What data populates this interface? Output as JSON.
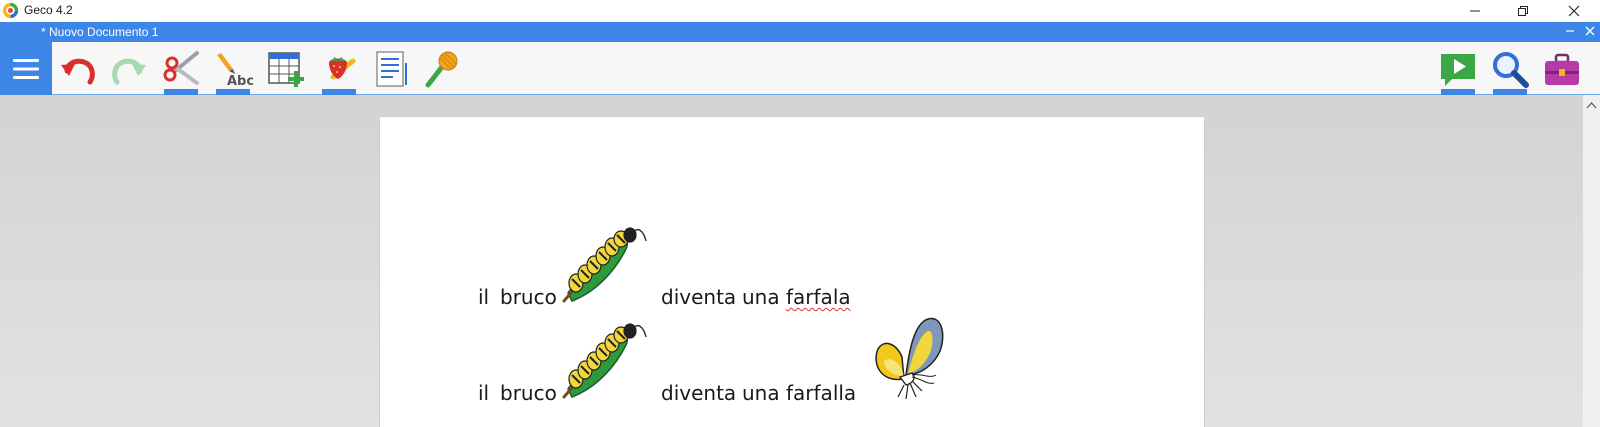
{
  "window": {
    "title": "Geco 4.2",
    "controls": [
      "minimize",
      "restore",
      "close"
    ]
  },
  "document_tab": {
    "title": "*  Nuovo Documento 1"
  },
  "toolbar": {
    "left_tools": [
      {
        "name": "menu",
        "icon": "hamburger-icon"
      },
      {
        "name": "undo",
        "icon": "undo-icon",
        "color": "#d9302c"
      },
      {
        "name": "redo",
        "icon": "redo-icon",
        "color": "#a8d8b0"
      },
      {
        "name": "cut",
        "icon": "scissors-icon",
        "active_marker": true
      },
      {
        "name": "spell-check",
        "icon": "pencil-abc-icon",
        "active_marker": true
      },
      {
        "name": "insert-table",
        "icon": "table-add-icon"
      },
      {
        "name": "symbols",
        "icon": "strawberry-icon",
        "active_marker": true
      },
      {
        "name": "document-list",
        "icon": "document-lines-icon"
      },
      {
        "name": "voice",
        "icon": "microphone-icon"
      }
    ],
    "right_tools": [
      {
        "name": "read-aloud",
        "icon": "play-speech-icon",
        "color": "#3aa845",
        "active_marker": true
      },
      {
        "name": "search",
        "icon": "magnifier-icon",
        "color": "#2f6fd6",
        "active_marker": true
      },
      {
        "name": "toolbox",
        "icon": "briefcase-icon",
        "color": "#b83aa8"
      }
    ]
  },
  "document": {
    "lines": [
      {
        "words": [
          "il",
          "bruco",
          "diventa",
          "una",
          "farfala"
        ],
        "misspelled": [
          "farfala"
        ],
        "pictures": [
          {
            "icon": "caterpillar-icon",
            "after_word": "bruco"
          }
        ]
      },
      {
        "words": [
          "il",
          "bruco",
          "diventa",
          "una",
          "farfalla"
        ],
        "misspelled": [],
        "pictures": [
          {
            "icon": "caterpillar-icon",
            "after_word": "bruco"
          },
          {
            "icon": "butterfly-icon",
            "after_word": "farfalla"
          }
        ]
      }
    ]
  },
  "colors": {
    "accent": "#3d86e8",
    "toolbar_bg": "#f7f7f7",
    "workspace_bg": "#d9d9d9",
    "page_bg": "#ffffff",
    "misspell_underline": "#e0303a"
  }
}
